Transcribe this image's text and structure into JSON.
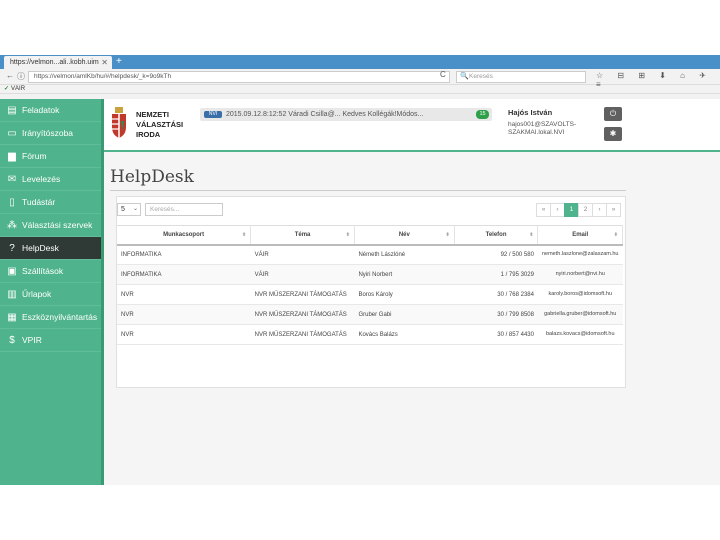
{
  "browser": {
    "tab_title": "https://velmon...ali..kobh.uim",
    "tab_close": "✕",
    "new_tab": "+",
    "back": "←",
    "info": "ⓘ",
    "url": "https://velmon/amlKb/hu/#/helpdesk/_k=9o9kTh",
    "reload": "C",
    "search_placeholder": "Keresés",
    "search_glyph": "🔍",
    "toolbar_icons": "☆ ⊟ ⊞ ⬇ ⌂ ✈ ≡",
    "bookmark_check": "✓",
    "bookmark": "VÁIR"
  },
  "sidebar": {
    "items": [
      {
        "label": "Feladatok",
        "icon": "▤"
      },
      {
        "label": "Irányítószoba",
        "icon": "▭"
      },
      {
        "label": "Fórum",
        "icon": "▆"
      },
      {
        "label": "Levelezés",
        "icon": "✉"
      },
      {
        "label": "Tudástár",
        "icon": "▯"
      },
      {
        "label": "Választási szervek",
        "icon": "⁂"
      },
      {
        "label": "HelpDesk",
        "icon": "?"
      },
      {
        "label": "Szállítások",
        "icon": "▣"
      },
      {
        "label": "Űrlapok",
        "icon": "▥"
      },
      {
        "label": "Eszköznyilvántartás",
        "icon": "▦"
      },
      {
        "label": "VPIR",
        "icon": "$"
      }
    ],
    "active_index": 6
  },
  "header": {
    "org_line1": "NEMZETI",
    "org_line2": "VÁLASZTÁSI",
    "org_line3": "IRODA",
    "news_badge": "NVI",
    "news_text": "2015.09.12.8:12:52    Váradi Csilla@...    Kedves Kollégák!Módos...",
    "news_count": "15",
    "user_name": "Hajós István",
    "user_email": "hajos001@SZAVOLTS-SZAKMAI.lokal.NVI",
    "power_glyph": "⏻",
    "settings_glyph": "✱",
    "colors": {
      "accent": "#4fb38d",
      "badge": "#3a6ea8",
      "count": "#2fa04a"
    }
  },
  "page": {
    "title": "HelpDesk",
    "per_page": "5",
    "per_page_caret": "⌄",
    "filter_placeholder": "Keresés...",
    "pager": [
      "«",
      "‹",
      "1",
      "2",
      "›",
      "»"
    ],
    "pager_active": 2,
    "sort_glyph": "⬍",
    "columns": [
      "Munkacsoport",
      "Téma",
      "Név",
      "Telefon",
      "Email"
    ],
    "rows": [
      [
        "INFORMATIKA",
        "VÁIR",
        "Németh Lászlóné",
        "92 / 500 580",
        "nemeth.laszlone@zalaszam.hu"
      ],
      [
        "INFORMATIKA",
        "VÁIR",
        "Nyiri Norbert",
        "1 / 795 3029",
        "nyiri.norbert@nvi.hu"
      ],
      [
        "NVR",
        "NVR MŰSZERZANI TÁMOGATÁS",
        "Boros Károly",
        "30 / 768 2384",
        "karoly.boros@idomsoft.hu"
      ],
      [
        "NVR",
        "NVR MŰSZERZANI TÁMOGATÁS",
        "Gruber Gabi",
        "30 / 799 8508",
        "gabriella.gruber@idomsoft.hu"
      ],
      [
        "NVR",
        "NVR MŰSZERZANI TÁMOGATÁS",
        "Kovács Balázs",
        "30 / 857 4430",
        "balazs.kovacs@idomsoft.hu"
      ]
    ]
  }
}
